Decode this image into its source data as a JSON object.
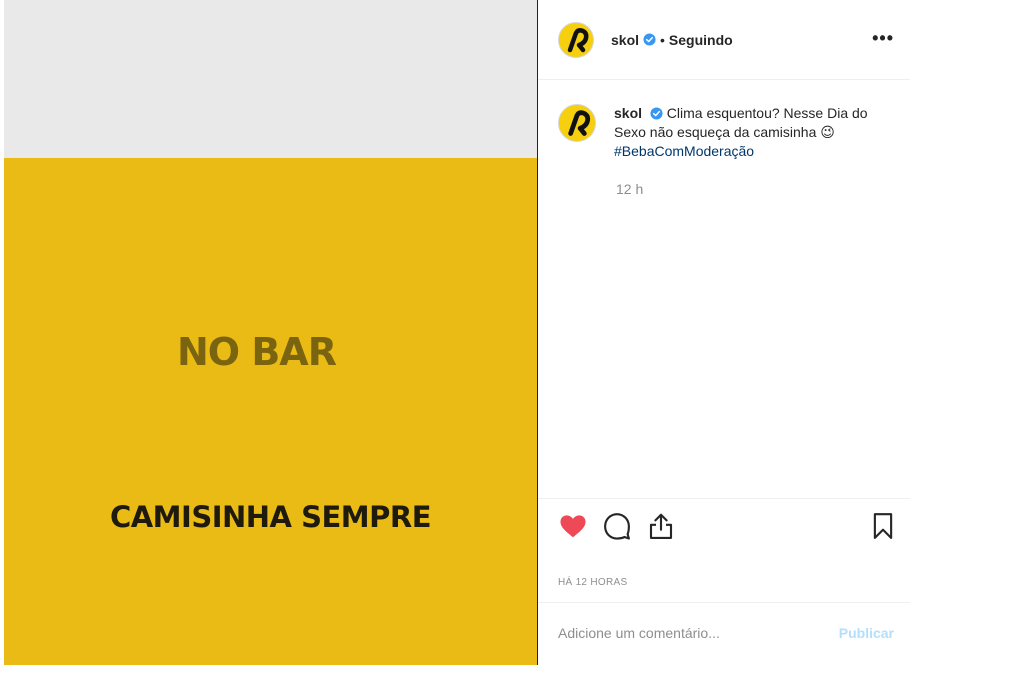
{
  "media": {
    "line1": "NO BAR",
    "line2": "CAMISINHA SEMPRE",
    "background_top": "#e9e9e9",
    "background_band": "#ebbb15"
  },
  "header": {
    "username": "skol",
    "separator": "•",
    "following": "Seguindo",
    "more": "•••"
  },
  "caption": {
    "username": "skol",
    "text": "Clima esquentou? Nesse Dia do Sexo não esqueça da camisinha 😉",
    "hashtag": "#BebaComModeração",
    "time": "12 h"
  },
  "actions": {
    "icons": [
      "heart-icon",
      "comment-icon",
      "share-icon",
      "bookmark-icon"
    ],
    "liked": true,
    "timestamp": "HÁ 12 HORAS"
  },
  "comment": {
    "placeholder": "Adicione um comentário...",
    "publish": "Publicar"
  },
  "colors": {
    "brand_yellow": "#f6cf0f",
    "like_red": "#ed4956",
    "link_blue": "#00376b",
    "verified_blue": "#3897f0"
  }
}
